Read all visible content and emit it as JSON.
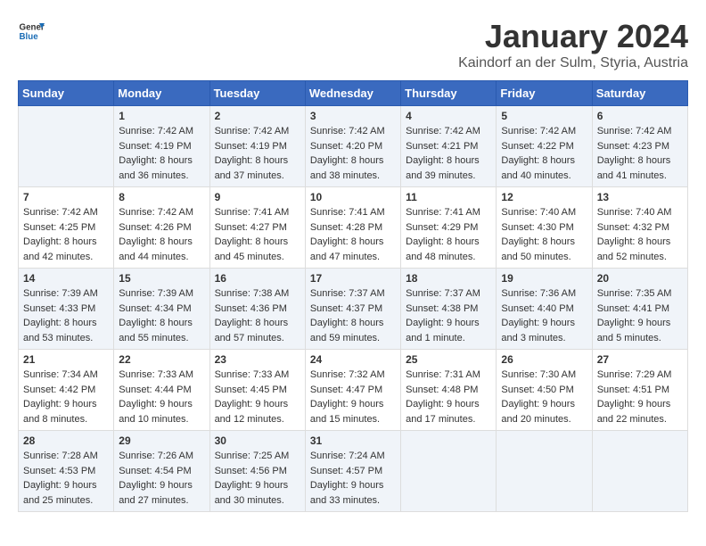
{
  "header": {
    "logo_general": "General",
    "logo_blue": "Blue",
    "title": "January 2024",
    "subtitle": "Kaindorf an der Sulm, Styria, Austria"
  },
  "days_of_week": [
    "Sunday",
    "Monday",
    "Tuesday",
    "Wednesday",
    "Thursday",
    "Friday",
    "Saturday"
  ],
  "weeks": [
    [
      {
        "day": "",
        "sunrise": "",
        "sunset": "",
        "daylight": ""
      },
      {
        "day": "1",
        "sunrise": "Sunrise: 7:42 AM",
        "sunset": "Sunset: 4:19 PM",
        "daylight": "Daylight: 8 hours and 36 minutes."
      },
      {
        "day": "2",
        "sunrise": "Sunrise: 7:42 AM",
        "sunset": "Sunset: 4:19 PM",
        "daylight": "Daylight: 8 hours and 37 minutes."
      },
      {
        "day": "3",
        "sunrise": "Sunrise: 7:42 AM",
        "sunset": "Sunset: 4:20 PM",
        "daylight": "Daylight: 8 hours and 38 minutes."
      },
      {
        "day": "4",
        "sunrise": "Sunrise: 7:42 AM",
        "sunset": "Sunset: 4:21 PM",
        "daylight": "Daylight: 8 hours and 39 minutes."
      },
      {
        "day": "5",
        "sunrise": "Sunrise: 7:42 AM",
        "sunset": "Sunset: 4:22 PM",
        "daylight": "Daylight: 8 hours and 40 minutes."
      },
      {
        "day": "6",
        "sunrise": "Sunrise: 7:42 AM",
        "sunset": "Sunset: 4:23 PM",
        "daylight": "Daylight: 8 hours and 41 minutes."
      }
    ],
    [
      {
        "day": "7",
        "sunrise": "Sunrise: 7:42 AM",
        "sunset": "Sunset: 4:25 PM",
        "daylight": "Daylight: 8 hours and 42 minutes."
      },
      {
        "day": "8",
        "sunrise": "Sunrise: 7:42 AM",
        "sunset": "Sunset: 4:26 PM",
        "daylight": "Daylight: 8 hours and 44 minutes."
      },
      {
        "day": "9",
        "sunrise": "Sunrise: 7:41 AM",
        "sunset": "Sunset: 4:27 PM",
        "daylight": "Daylight: 8 hours and 45 minutes."
      },
      {
        "day": "10",
        "sunrise": "Sunrise: 7:41 AM",
        "sunset": "Sunset: 4:28 PM",
        "daylight": "Daylight: 8 hours and 47 minutes."
      },
      {
        "day": "11",
        "sunrise": "Sunrise: 7:41 AM",
        "sunset": "Sunset: 4:29 PM",
        "daylight": "Daylight: 8 hours and 48 minutes."
      },
      {
        "day": "12",
        "sunrise": "Sunrise: 7:40 AM",
        "sunset": "Sunset: 4:30 PM",
        "daylight": "Daylight: 8 hours and 50 minutes."
      },
      {
        "day": "13",
        "sunrise": "Sunrise: 7:40 AM",
        "sunset": "Sunset: 4:32 PM",
        "daylight": "Daylight: 8 hours and 52 minutes."
      }
    ],
    [
      {
        "day": "14",
        "sunrise": "Sunrise: 7:39 AM",
        "sunset": "Sunset: 4:33 PM",
        "daylight": "Daylight: 8 hours and 53 minutes."
      },
      {
        "day": "15",
        "sunrise": "Sunrise: 7:39 AM",
        "sunset": "Sunset: 4:34 PM",
        "daylight": "Daylight: 8 hours and 55 minutes."
      },
      {
        "day": "16",
        "sunrise": "Sunrise: 7:38 AM",
        "sunset": "Sunset: 4:36 PM",
        "daylight": "Daylight: 8 hours and 57 minutes."
      },
      {
        "day": "17",
        "sunrise": "Sunrise: 7:37 AM",
        "sunset": "Sunset: 4:37 PM",
        "daylight": "Daylight: 8 hours and 59 minutes."
      },
      {
        "day": "18",
        "sunrise": "Sunrise: 7:37 AM",
        "sunset": "Sunset: 4:38 PM",
        "daylight": "Daylight: 9 hours and 1 minute."
      },
      {
        "day": "19",
        "sunrise": "Sunrise: 7:36 AM",
        "sunset": "Sunset: 4:40 PM",
        "daylight": "Daylight: 9 hours and 3 minutes."
      },
      {
        "day": "20",
        "sunrise": "Sunrise: 7:35 AM",
        "sunset": "Sunset: 4:41 PM",
        "daylight": "Daylight: 9 hours and 5 minutes."
      }
    ],
    [
      {
        "day": "21",
        "sunrise": "Sunrise: 7:34 AM",
        "sunset": "Sunset: 4:42 PM",
        "daylight": "Daylight: 9 hours and 8 minutes."
      },
      {
        "day": "22",
        "sunrise": "Sunrise: 7:33 AM",
        "sunset": "Sunset: 4:44 PM",
        "daylight": "Daylight: 9 hours and 10 minutes."
      },
      {
        "day": "23",
        "sunrise": "Sunrise: 7:33 AM",
        "sunset": "Sunset: 4:45 PM",
        "daylight": "Daylight: 9 hours and 12 minutes."
      },
      {
        "day": "24",
        "sunrise": "Sunrise: 7:32 AM",
        "sunset": "Sunset: 4:47 PM",
        "daylight": "Daylight: 9 hours and 15 minutes."
      },
      {
        "day": "25",
        "sunrise": "Sunrise: 7:31 AM",
        "sunset": "Sunset: 4:48 PM",
        "daylight": "Daylight: 9 hours and 17 minutes."
      },
      {
        "day": "26",
        "sunrise": "Sunrise: 7:30 AM",
        "sunset": "Sunset: 4:50 PM",
        "daylight": "Daylight: 9 hours and 20 minutes."
      },
      {
        "day": "27",
        "sunrise": "Sunrise: 7:29 AM",
        "sunset": "Sunset: 4:51 PM",
        "daylight": "Daylight: 9 hours and 22 minutes."
      }
    ],
    [
      {
        "day": "28",
        "sunrise": "Sunrise: 7:28 AM",
        "sunset": "Sunset: 4:53 PM",
        "daylight": "Daylight: 9 hours and 25 minutes."
      },
      {
        "day": "29",
        "sunrise": "Sunrise: 7:26 AM",
        "sunset": "Sunset: 4:54 PM",
        "daylight": "Daylight: 9 hours and 27 minutes."
      },
      {
        "day": "30",
        "sunrise": "Sunrise: 7:25 AM",
        "sunset": "Sunset: 4:56 PM",
        "daylight": "Daylight: 9 hours and 30 minutes."
      },
      {
        "day": "31",
        "sunrise": "Sunrise: 7:24 AM",
        "sunset": "Sunset: 4:57 PM",
        "daylight": "Daylight: 9 hours and 33 minutes."
      },
      {
        "day": "",
        "sunrise": "",
        "sunset": "",
        "daylight": ""
      },
      {
        "day": "",
        "sunrise": "",
        "sunset": "",
        "daylight": ""
      },
      {
        "day": "",
        "sunrise": "",
        "sunset": "",
        "daylight": ""
      }
    ]
  ]
}
